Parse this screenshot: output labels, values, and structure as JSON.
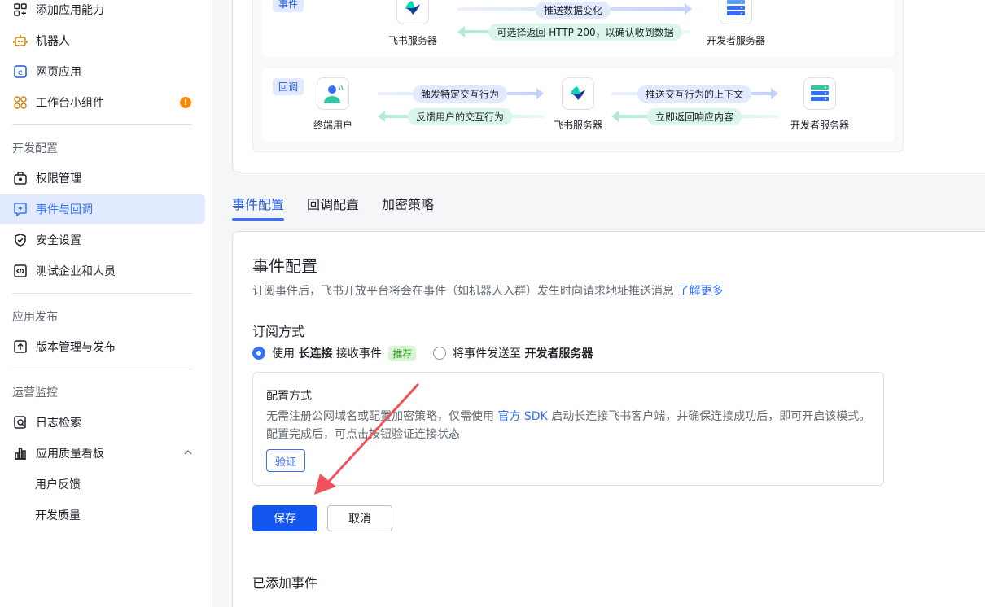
{
  "sidebar": {
    "top_items": [
      {
        "label": "添加应用能力",
        "icon": "grid-plus-icon"
      },
      {
        "label": "机器人",
        "icon": "robot-icon"
      },
      {
        "label": "网页应用",
        "icon": "web-app-icon"
      },
      {
        "label": "工作台小组件",
        "icon": "widget-icon",
        "badge": "!"
      }
    ],
    "dev_section": "开发配置",
    "dev_items": [
      {
        "label": "权限管理",
        "icon": "permission-icon"
      },
      {
        "label": "事件与回调",
        "icon": "event-callback-icon"
      },
      {
        "label": "安全设置",
        "icon": "shield-icon"
      },
      {
        "label": "测试企业和人员",
        "icon": "test-code-icon"
      }
    ],
    "publish_section": "应用发布",
    "publish_items": [
      {
        "label": "版本管理与发布",
        "icon": "upload-icon"
      }
    ],
    "ops_section": "运营监控",
    "ops_items": [
      {
        "label": "日志检索",
        "icon": "log-search-icon"
      },
      {
        "label": "应用质量看板",
        "icon": "bar-chart-icon"
      }
    ],
    "ops_sub_items": [
      "用户反馈",
      "开发质量"
    ]
  },
  "flow": {
    "event_tag": "事件",
    "event_push": "推送数据变化",
    "event_return": "可选择返回 HTTP 200，以确认收到数据",
    "feishu_server": "飞书服务器",
    "dev_server": "开发者服务器",
    "callback_tag": "回调",
    "end_user": "终端用户",
    "trigger": "触发特定交互行为",
    "feedback": "反馈用户的交互行为",
    "push_context": "推送交互行为的上下文",
    "return_resp": "立即返回响应内容"
  },
  "tabs": [
    "事件配置",
    "回调配置",
    "加密策略"
  ],
  "main": {
    "title": "事件配置",
    "desc": "订阅事件后，飞书开放平台将会在事件（如机器人入群）发生时向请求地址推送消息",
    "learn_more": "了解更多",
    "sub_title": "订阅方式",
    "opt1_prefix": "使用",
    "opt1_bold": "长连接",
    "opt1_suffix": "接收事件",
    "opt1_badge": "推荐",
    "opt2_prefix": "将事件发送至",
    "opt2_bold": "开发者服务器",
    "cfg_title": "配置方式",
    "cfg_line1_a": "无需注册公网域名或配置加密策略，仅需使用",
    "cfg_line1_link": "官方 SDK",
    "cfg_line1_b": "启动长连接飞书客户端，并确保连接成功后，即可开启该模式。",
    "cfg_line2": "配置完成后，可点击按钮验证连接状态",
    "verify": "验证",
    "save": "保存",
    "cancel": "取消",
    "added_events": "已添加事件"
  },
  "colors": {
    "primary": "#3370ff",
    "annotation": "#f0525b",
    "warning": "#ff8800"
  }
}
